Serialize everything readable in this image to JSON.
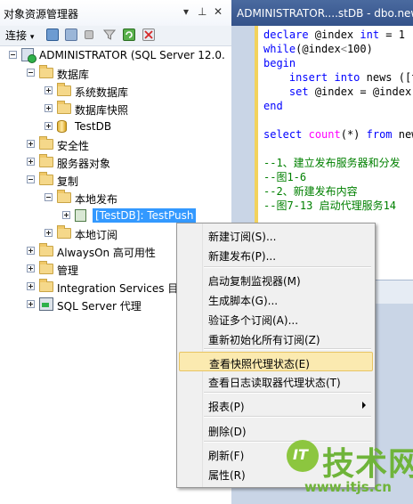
{
  "object_explorer": {
    "title": "对象资源管理器",
    "title_controls": [
      "▾",
      "⊥",
      "✕"
    ],
    "toolbar": {
      "connect_label": "连接"
    },
    "tree": [
      {
        "label": "ADMINISTRATOR (SQL Server 12.0.",
        "level": 0,
        "icon": "server-icon",
        "expander": "minus"
      },
      {
        "label": "数据库",
        "level": 1,
        "icon": "folder-icon",
        "expander": "minus"
      },
      {
        "label": "系统数据库",
        "level": 2,
        "icon": "folder-icon",
        "expander": "plus"
      },
      {
        "label": "数据库快照",
        "level": 2,
        "icon": "folder-icon",
        "expander": "plus"
      },
      {
        "label": "TestDB",
        "level": 2,
        "icon": "database-icon",
        "expander": "plus"
      },
      {
        "label": "安全性",
        "level": 1,
        "icon": "folder-icon",
        "expander": "plus"
      },
      {
        "label": "服务器对象",
        "level": 1,
        "icon": "folder-icon",
        "expander": "plus"
      },
      {
        "label": "复制",
        "level": 1,
        "icon": "folder-icon",
        "expander": "minus"
      },
      {
        "label": "本地发布",
        "level": 2,
        "icon": "folder-icon",
        "expander": "minus"
      },
      {
        "label": "[TestDB]: TestPush",
        "level": 3,
        "icon": "publication-icon",
        "expander": "plus",
        "selected": true
      },
      {
        "label": "本地订阅",
        "level": 2,
        "icon": "folder-icon",
        "expander": "plus"
      },
      {
        "label": "AlwaysOn 高可用性",
        "level": 1,
        "icon": "folder-icon",
        "expander": "plus"
      },
      {
        "label": "管理",
        "level": 1,
        "icon": "folder-icon",
        "expander": "plus"
      },
      {
        "label": "Integration Services 目录",
        "level": 1,
        "icon": "folder-icon",
        "expander": "plus"
      },
      {
        "label": "SQL Server 代理",
        "level": 1,
        "icon": "agent-icon",
        "expander": "plus"
      }
    ]
  },
  "editor": {
    "tab_title": "ADMINISTRATOR....stDB - dbo.news",
    "lines": [
      "declare @index int = 1",
      "while(@index<100)",
      "begin",
      "      insert into news ([t",
      "      set @index = @index",
      "end",
      "",
      "select count(*) from news",
      "",
      "--1、建立发布服务器和分发",
      "--图1-6",
      "--2、新建发布内容",
      "--图7-13 启动代理服务14"
    ]
  },
  "context_menu": {
    "items": [
      {
        "label": "新建订阅(S)..."
      },
      {
        "label": "新建发布(P)..."
      },
      {
        "label": "启动复制监视器(M)"
      },
      {
        "label": "生成脚本(G)..."
      },
      {
        "label": "验证多个订阅(A)..."
      },
      {
        "label": "重新初始化所有订阅(Z)"
      },
      {
        "label": "查看快照代理状态(E)",
        "highlighted": true
      },
      {
        "label": "查看日志读取器代理状态(T)"
      },
      {
        "label": "报表(P)",
        "submenu": true
      },
      {
        "label": "删除(D)"
      },
      {
        "label": "刷新(F)"
      },
      {
        "label": "属性(R)"
      }
    ],
    "highlight_color": "#fbeab0"
  },
  "watermark": {
    "logo_text": "IT",
    "name": "技术网",
    "url": "www.itjs.cn"
  }
}
